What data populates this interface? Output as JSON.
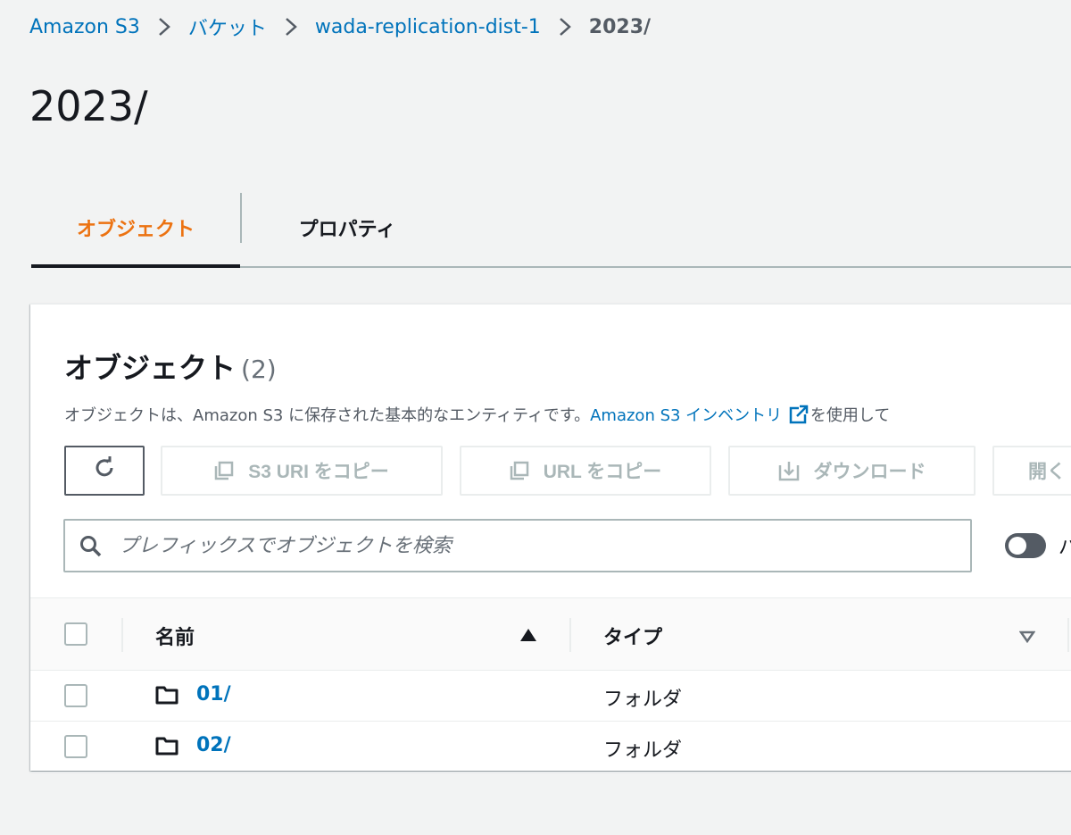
{
  "breadcrumb": {
    "items": [
      "Amazon S3",
      "バケット",
      "wada-replication-dist-1"
    ],
    "current": "2023/"
  },
  "page_title": "2023/",
  "tabs": [
    {
      "label": "オブジェクト",
      "active": true
    },
    {
      "label": "プロパティ",
      "active": false
    }
  ],
  "objects_panel": {
    "title": "オブジェクト",
    "count": "(2)",
    "description_prefix": "オブジェクトは、Amazon S3 に保存された基本的なエンティティです。",
    "description_link": "Amazon S3 インベントリ",
    "description_suffix": "を使用して"
  },
  "toolbar": {
    "copy_s3_uri_label": "S3 URI をコピー",
    "copy_url_label": "URL をコピー",
    "download_label": "ダウンロード",
    "open_label": "開く"
  },
  "search": {
    "placeholder": "プレフィックスでオブジェクトを検索"
  },
  "toggle_label": "バ",
  "table": {
    "columns": [
      "名前",
      "タイプ"
    ],
    "rows": [
      {
        "name": "01/",
        "type": "フォルダ"
      },
      {
        "name": "02/",
        "type": "フォルダ"
      }
    ]
  },
  "colors": {
    "link": "#0073bb",
    "active_tab": "#ec7211",
    "background": "#f2f3f3"
  }
}
